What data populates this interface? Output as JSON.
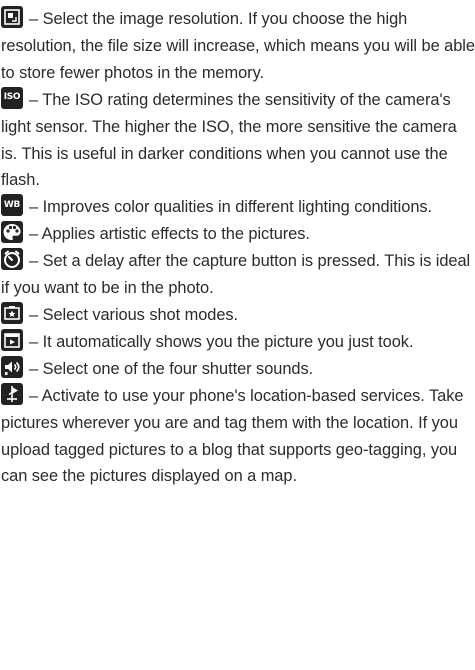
{
  "entries": [
    {
      "icon": "image-resolution-icon",
      "text": "– Select the image resolution. If you choose the high resolution, the file size will increase, which means you will be able to store fewer photos in the memory."
    },
    {
      "icon": "iso-icon",
      "icon_label": "ISO",
      "text": "– The ISO rating determines the sensitivity of the camera's light sensor. The higher the ISO, the more sensitive the camera is. This is useful in darker conditions when you cannot use the flash."
    },
    {
      "icon": "white-balance-icon",
      "icon_label": "WB",
      "text": "– Improves color qualities in different lighting conditions."
    },
    {
      "icon": "color-effect-palette-icon",
      "text": "– Applies artistic effects to the pictures."
    },
    {
      "icon": "timer-icon",
      "text": "– Set a delay after the capture button is pressed. This is ideal if you want to be in the photo."
    },
    {
      "icon": "shot-mode-icon",
      "text": "– Select various shot modes."
    },
    {
      "icon": "auto-review-icon",
      "text": "– It automatically shows you the picture you just took."
    },
    {
      "icon": "shutter-sound-icon",
      "text": "– Select one of the four shutter sounds."
    },
    {
      "icon": "geotag-location-icon",
      "text": "– Activate to use your phone's location-based services. Take pictures wherever you are and tag them with the location. If you upload tagged pictures to a blog that supports geo-tagging, you can see the pictures displayed on a map."
    }
  ]
}
